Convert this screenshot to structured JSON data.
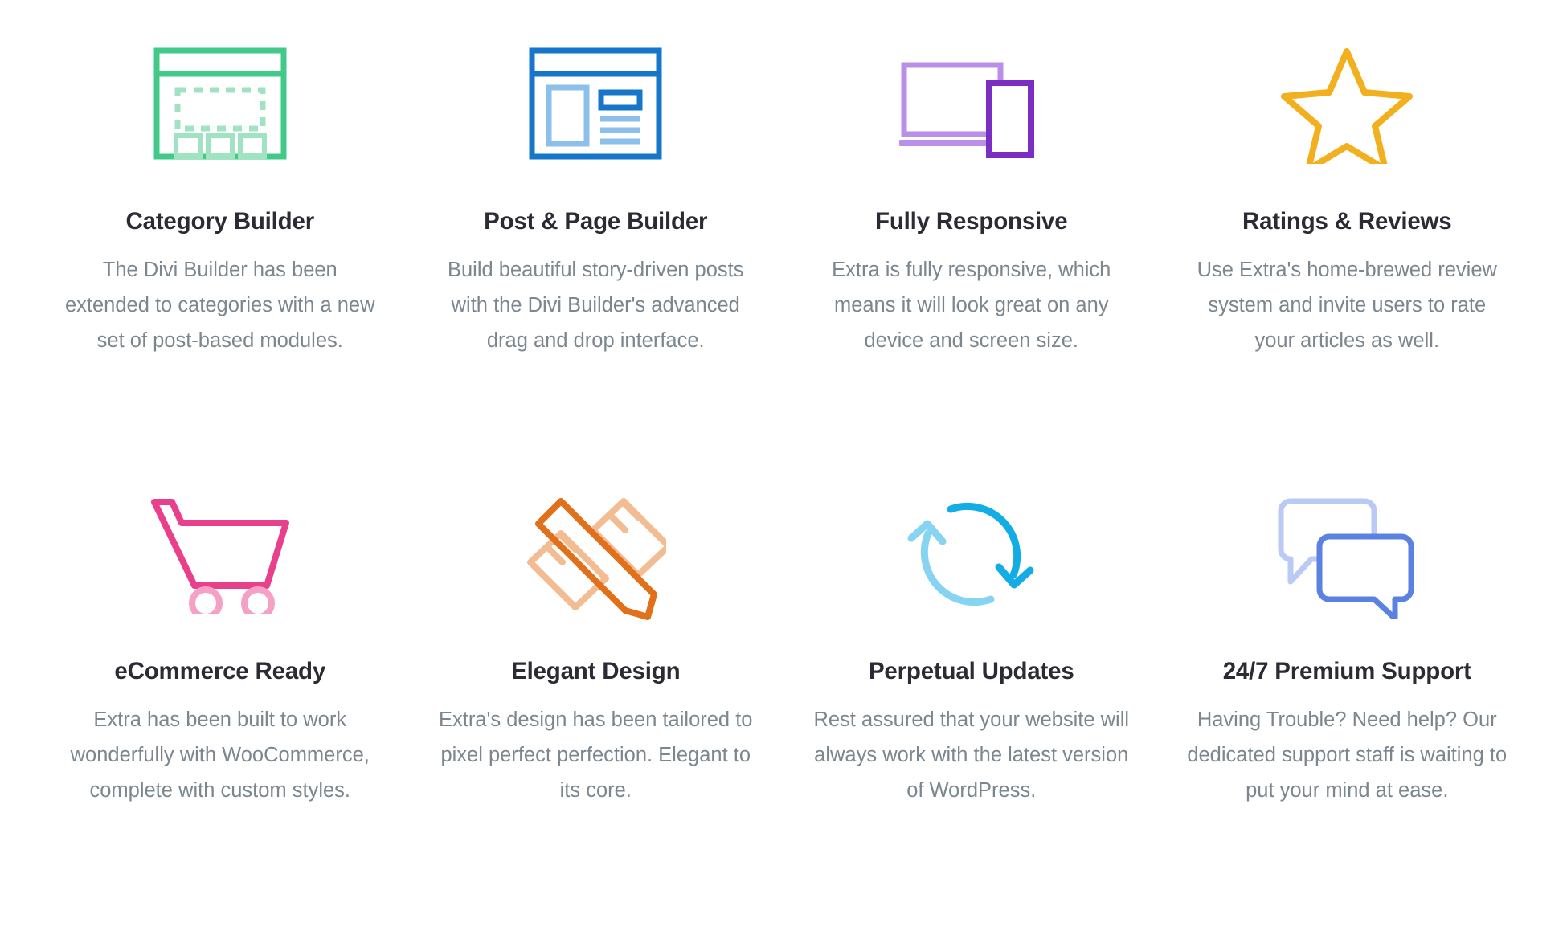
{
  "page": {
    "background_color": "#ffffff",
    "title_color": "#2b2b35",
    "text_color": "#7b868f"
  },
  "features": [
    {
      "icon": "category-builder-icon",
      "icon_colors": {
        "primary": "#41c98a",
        "secondary": "#9fe3c2"
      },
      "title": "Category Builder",
      "description": "The Divi Builder has been extended to categories with a new set of post-based modules."
    },
    {
      "icon": "post-page-builder-icon",
      "icon_colors": {
        "primary": "#1576ca",
        "secondary": "#8cbfe9"
      },
      "title": "Post & Page Builder",
      "description": "Build beautiful story-driven posts with the Divi Builder's advanced drag and drop interface."
    },
    {
      "icon": "fully-responsive-icon",
      "icon_colors": {
        "primary": "#7a2ec4",
        "secondary": "#bb8ee8"
      },
      "title": "Fully Responsive",
      "description": "Extra is fully responsive, which means it will look great on any device and screen size."
    },
    {
      "icon": "star-icon",
      "icon_colors": {
        "primary": "#f2b01e",
        "secondary": "#f7cf72"
      },
      "title": "Ratings & Reviews",
      "description": "Use Extra's home-brewed review system and invite users to rate your articles as well."
    },
    {
      "icon": "shopping-cart-icon",
      "icon_colors": {
        "primary": "#e8408a",
        "secondary": "#f5a1c6"
      },
      "title": "eCommerce Ready",
      "description": "Extra has been built to work wonderfully with WooCommerce, complete with custom styles."
    },
    {
      "icon": "pencil-ruler-icon",
      "icon_colors": {
        "primary": "#e1701b",
        "secondary": "#f3bd94"
      },
      "title": "Elegant Design",
      "description": "Extra's design has been tailored to pixel perfect perfection. Elegant to its core."
    },
    {
      "icon": "refresh-cycle-icon",
      "icon_colors": {
        "primary": "#13ace4",
        "secondary": "#86d4f2"
      },
      "title": "Perpetual Updates",
      "description": "Rest assured that your website will always work with the latest version of WordPress."
    },
    {
      "icon": "chat-bubbles-icon",
      "icon_colors": {
        "primary": "#5b82e0",
        "secondary": "#b9caf5"
      },
      "title": "24/7 Premium Support",
      "description": "Having Trouble? Need help? Our dedicated support staff is waiting to put your mind at ease."
    }
  ]
}
